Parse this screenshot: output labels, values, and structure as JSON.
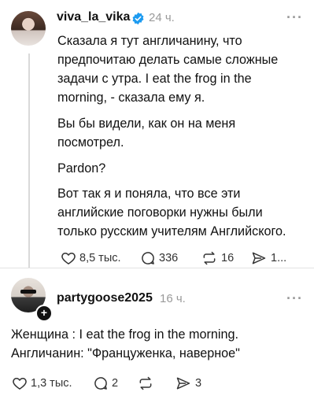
{
  "post1": {
    "username": "viva_la_vika",
    "time": "24 ч.",
    "more": "···",
    "paragraphs": [
      [
        "Сказала я тут англичанину, что",
        "предпочитаю делать самые сложные",
        "задачи с утра. I eat the frog in the",
        "morning, - сказала ему я."
      ],
      [
        "Вы бы видели, как он на меня",
        "посмотрел."
      ],
      [
        "Pardon?"
      ],
      [
        "Вот так я и поняла, что все эти",
        "английские поговорки нужны были",
        "только русским учителям Английского."
      ]
    ],
    "actions": {
      "likes": "8,5 тыс.",
      "comments": "336",
      "reposts": "16",
      "shares": "1..."
    }
  },
  "post2": {
    "username": "partygoose2025",
    "time": "16 ч.",
    "more": "···",
    "follow_badge": "+",
    "lines": [
      "Женщина : I eat the frog in the morning.",
      "Англичанин: \"Француженка, наверное\""
    ],
    "actions": {
      "likes": "1,3 тыс.",
      "comments": "2",
      "shares": "3"
    }
  },
  "colors": {
    "verified": "#1d9bf0",
    "muted": "#9a9a9a"
  }
}
